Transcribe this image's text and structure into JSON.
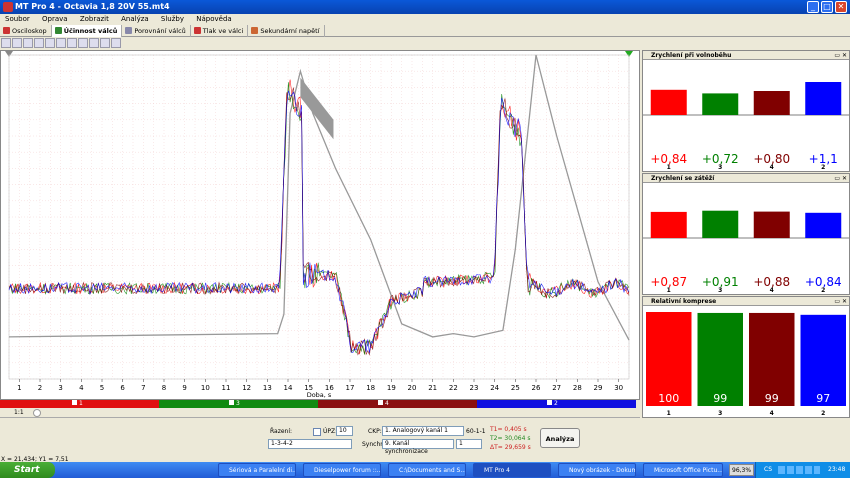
{
  "window": {
    "title": "MT Pro 4 - Octavia 1,8 20V 55.mt4",
    "min": "_",
    "max": "□",
    "close": "✕",
    "close_color": "#d8452b"
  },
  "menu": [
    "Soubor",
    "Oprava",
    "Zobrazit",
    "Analýza",
    "Služby",
    "Nápověda"
  ],
  "tabs": [
    {
      "label": "Osciloskop",
      "icon": "oscilloscope-icon",
      "color": "#c33"
    },
    {
      "label": "Účinnost válců",
      "icon": "cylinder-efficiency-icon",
      "color": "#383",
      "active": true
    },
    {
      "label": "Porovnání válců",
      "icon": "compare-cylinders-icon",
      "color": "#88a"
    },
    {
      "label": "Tlak ve válci",
      "icon": "pressure-icon",
      "color": "#c33"
    },
    {
      "label": "Sekundární napětí",
      "icon": "secondary-voltage-icon",
      "color": "#c63"
    }
  ],
  "chart_data": {
    "type": "line",
    "xlabel": "Doba, s",
    "xlim": [
      0.5,
      30.5
    ],
    "x_ticks": [
      1,
      2,
      3,
      4,
      5,
      6,
      7,
      8,
      9,
      10,
      11,
      12,
      13,
      14,
      15,
      16,
      17,
      18,
      19,
      20,
      21,
      22,
      23,
      24,
      25,
      26,
      27,
      28,
      29,
      30
    ],
    "grid": true,
    "series": [
      {
        "name": "1",
        "color": "#ff0000"
      },
      {
        "name": "3",
        "color": "#008000"
      },
      {
        "name": "4",
        "color": "#800000"
      },
      {
        "name": "2",
        "color": "#0000ff"
      }
    ]
  },
  "channels": [
    {
      "label": "1",
      "color": "#e01010"
    },
    {
      "label": "3",
      "color": "#108a10"
    },
    {
      "label": "4",
      "color": "#8a1010"
    },
    {
      "label": "2",
      "color": "#1010e0"
    }
  ],
  "scroll": {
    "zoom": "1:1"
  },
  "controls": {
    "razeni_label": "Řazení:",
    "upz_label": "ÚPZ:",
    "upz_value": "10",
    "order_value": "1-3-4-2",
    "ckp_label": "CKP:",
    "ckp_value": "1. Analogový kanál 1",
    "ckp_ratio": "60-1-1",
    "sync_label": "Synchro:",
    "sync_value": "9. Kanál synchronizace",
    "sync_num": "1",
    "t1": "T1= 0,405 s",
    "t2": "T2= 30,064 s",
    "dt": "ΔT= 29,659 s",
    "t1_color": "#cc2222",
    "t2_color": "#228822",
    "dt_color": "#cc2222",
    "analyza_label": "Analýza"
  },
  "coord_readout": "X = 21,434; Y1 = 7,51",
  "panels": [
    {
      "title": "Zrychlení při volnoběhu",
      "bars": [
        {
          "label": "1",
          "value": 0.84,
          "text": "+0,84",
          "color": "#ff0000"
        },
        {
          "label": "3",
          "value": 0.72,
          "text": "+0,72",
          "color": "#008000"
        },
        {
          "label": "4",
          "value": 0.8,
          "text": "+0,80",
          "color": "#800000"
        },
        {
          "label": "2",
          "value": 1.1,
          "text": "+1,1",
          "color": "#0000ff"
        }
      ]
    },
    {
      "title": "Zrychlení se zátěží",
      "bars": [
        {
          "label": "1",
          "value": 0.87,
          "text": "+0,87",
          "color": "#ff0000"
        },
        {
          "label": "3",
          "value": 0.91,
          "text": "+0,91",
          "color": "#008000"
        },
        {
          "label": "4",
          "value": 0.88,
          "text": "+0,88",
          "color": "#800000"
        },
        {
          "label": "2",
          "value": 0.84,
          "text": "+0,84",
          "color": "#0000ff"
        }
      ]
    },
    {
      "title": "Relativní komprese",
      "bars": [
        {
          "label": "1",
          "value": 100,
          "text": "100",
          "color": "#ff0000"
        },
        {
          "label": "3",
          "value": 99,
          "text": "99",
          "color": "#008000"
        },
        {
          "label": "4",
          "value": 99,
          "text": "99",
          "color": "#800000"
        },
        {
          "label": "2",
          "value": 97,
          "text": "97",
          "color": "#0000ff"
        }
      ]
    }
  ],
  "taskbar": {
    "start": "Start",
    "tasks": [
      "Sériová a Paralelní di...",
      "Dieselpower forum ::...",
      "C:\\Documents and S...",
      "MT Pro 4",
      "Nový obrázek - Dokum...",
      "Microsoft Office Pictu..."
    ],
    "zoom": "96,3%",
    "lang": "CS",
    "clock": "23:48"
  }
}
